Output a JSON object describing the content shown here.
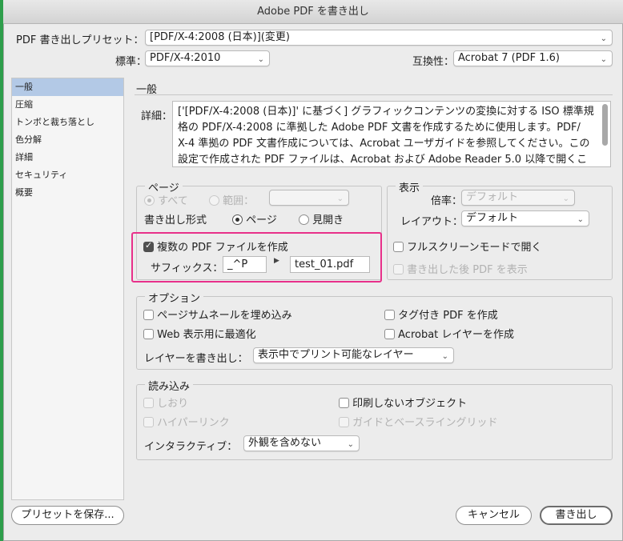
{
  "window": {
    "title": "Adobe PDF を書き出し"
  },
  "preset": {
    "label": "PDF 書き出しプリセット：",
    "value": "[PDF/X-4:2008 (日本)](変更)"
  },
  "standard": {
    "label": "標準：",
    "value": "PDF/X-4:2010"
  },
  "compat": {
    "label": "互換性：",
    "value": "Acrobat 7 (PDF 1.6)"
  },
  "sidebar": {
    "items": [
      {
        "label": "一般"
      },
      {
        "label": "圧縮"
      },
      {
        "label": "トンボと裁ち落とし"
      },
      {
        "label": "色分解"
      },
      {
        "label": "詳細"
      },
      {
        "label": "セキュリティ"
      },
      {
        "label": "概要"
      }
    ]
  },
  "general": {
    "heading": "一般",
    "details_label": "詳細：",
    "details_lines": [
      "['[PDF/X-4:2008 (日本)]' に基づく] グラフィックコンテンツの変換に対する ISO 標準規",
      "格の PDF/X-4:2008 に準拠した Adobe PDF 文書を作成するために使用します。PDF/",
      "X-4 準拠の PDF 文書作成については、Acrobat ユーザガイドを参照してください。この",
      "設定で作成された PDF ファイルは、Acrobat および Adobe Reader 5.0 以降で開くこ"
    ]
  },
  "page": {
    "title": "ページ",
    "all": "すべて",
    "range": "範囲：",
    "export_label": "書き出し形式",
    "export_page": "ページ",
    "export_spread": "見開き",
    "multi_pdf": "複数の PDF ファイルを作成",
    "suffix_label": "サフィックス：",
    "suffix_value": "_^P",
    "preview_value": "test_01.pdf"
  },
  "view": {
    "title": "表示",
    "zoom_label": "倍率：",
    "zoom_value": "デフォルト",
    "layout_label": "レイアウト：",
    "layout_value": "デフォルト",
    "fullscreen": "フルスクリーンモードで開く",
    "view_after": "書き出した後 PDF を表示"
  },
  "options": {
    "title": "オプション",
    "embed_thumbs": "ページサムネールを埋め込み",
    "web_optimize": "Web 表示用に最適化",
    "tagged_pdf": "タグ付き PDF を作成",
    "acrobat_layers": "Acrobat レイヤーを作成",
    "layers_label": "レイヤーを書き出し：",
    "layers_value": "表示中でプリント可能なレイヤー"
  },
  "include": {
    "title": "読み込み",
    "bookmarks": "しおり",
    "hyperlinks": "ハイパーリンク",
    "nonprinting": "印刷しないオブジェクト",
    "guides": "ガイドとベースライングリッド",
    "interactive_label": "インタラクティブ：",
    "interactive_value": "外観を含めない"
  },
  "buttons": {
    "save_preset": "プリセットを保存...",
    "cancel": "キャンセル",
    "export": "書き出し"
  }
}
